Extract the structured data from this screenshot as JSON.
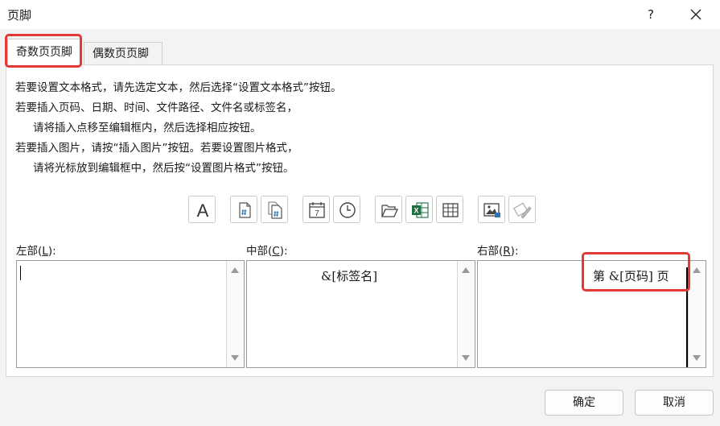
{
  "window": {
    "title": "页脚",
    "help": "?"
  },
  "tabs": [
    {
      "label": "奇数页页脚",
      "active": true
    },
    {
      "label": "偶数页页脚",
      "active": false
    }
  ],
  "instructions": [
    "若要设置文本格式，请先选定文本，然后选择“设置文本格式”按钮。",
    "若要插入页码、日期、时间、文件路径、文件名或标签名，",
    "请将插入点移至编辑框内，然后选择相应按钮。",
    "若要插入图片，请按“插入图片”按钮。若要设置图片格式，",
    "请将光标放到编辑框中，然后按“设置图片格式”按钮。"
  ],
  "toolbar": [
    {
      "icon": "format-text-icon",
      "glyph": "A"
    },
    {
      "icon": "insert-page-number-icon"
    },
    {
      "icon": "insert-page-count-icon"
    },
    {
      "icon": "insert-date-icon",
      "glyph": "7"
    },
    {
      "icon": "insert-time-icon"
    },
    {
      "icon": "insert-file-path-icon"
    },
    {
      "icon": "insert-file-name-icon",
      "glyph": "X"
    },
    {
      "icon": "insert-sheet-name-icon"
    },
    {
      "icon": "insert-picture-icon"
    },
    {
      "icon": "format-picture-icon"
    }
  ],
  "sections": {
    "left": {
      "label_pre": "左部(",
      "key": "L",
      "label_post": "):",
      "value": ""
    },
    "center": {
      "label_pre": "中部(",
      "key": "C",
      "label_post": "):",
      "value": "&[标签名]"
    },
    "right": {
      "label_pre": "右部(",
      "key": "R",
      "label_post": "):",
      "value": "第 &[页码] 页"
    }
  },
  "buttons": {
    "ok": "确定",
    "cancel": "取消"
  },
  "colors": {
    "highlight": "#e53935",
    "background": "#f3f3f3",
    "excel_green": "#1d6f42"
  }
}
